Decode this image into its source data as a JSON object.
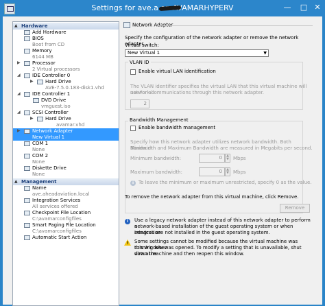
{
  "window": {
    "title": "Settings for ave.a                       on AVAMARHYPERV"
  },
  "hardware_label": "Hardware",
  "management_label": "Management",
  "hardware": [
    {
      "name": "Add Hardware",
      "sub": ""
    },
    {
      "name": "BIOS",
      "sub": "Boot from CD"
    },
    {
      "name": "Memory",
      "sub": "6144 MB"
    },
    {
      "name": "Processor",
      "sub": "2 Virtual processors"
    },
    {
      "name": "IDE Controller 0",
      "sub": ""
    },
    {
      "name": "Hard Drive",
      "sub": "AVE-7.5.0.183-disk1.vhd"
    },
    {
      "name": "IDE Controller 1",
      "sub": ""
    },
    {
      "name": "DVD Drive",
      "sub": "vmguest.iso"
    },
    {
      "name": "SCSI Controller",
      "sub": ""
    },
    {
      "name": "Hard Drive",
      "sub": "avamar.vhd"
    },
    {
      "name": "Network Adapter",
      "sub": "New Virtual  1"
    },
    {
      "name": "COM 1",
      "sub": "None"
    },
    {
      "name": "COM 2",
      "sub": "None"
    },
    {
      "name": "Diskette Drive",
      "sub": "None"
    }
  ],
  "management": [
    {
      "name": "Name",
      "sub": "ave.aheadaviation.local"
    },
    {
      "name": "Integration Services",
      "sub": "All services offered"
    },
    {
      "name": "Checkpoint File Location",
      "sub": "C:\\avamarconfigfiles"
    },
    {
      "name": "Smart Paging File Location",
      "sub": "C:\\avamarconfigfiles"
    },
    {
      "name": "Automatic Start Action",
      "sub": ""
    }
  ],
  "panel": {
    "title": "Network Adapter",
    "desc": "Specify the configuration of the network adapter or remove the network adapter.",
    "switch_label": "Virtual switch:",
    "switch_value": "New Virtual  1",
    "vlan_label": "VLAN ID",
    "vlan_checkbox": "Enable virtual LAN identification",
    "vlan_desc_1": "The VLAN identifier specifies the virtual LAN that this virtual machine will use for all",
    "vlan_desc_2": "network communications through this network adapter.",
    "vlan_value": "2",
    "bw_label": "Bandwidth Management",
    "bw_checkbox": "Enable bandwidth management",
    "bw_desc_1": "Specify how this network adapter utilizes network bandwidth. Both Minimum",
    "bw_desc_2": "Bandwidth and Maximum Bandwidth are measured in Megabits per second.",
    "min_label": "Minimum bandwidth:",
    "min_value": "0",
    "max_label": "Maximum bandwidth:",
    "max_value": "0",
    "unit": "Mbps",
    "bw_note": "To leave the minimum or maximum unrestricted, specify 0 as the value.",
    "remove_desc": "To remove the network adapter from this virtual machine, click Remove.",
    "remove_button": "Remove",
    "info_1": "Use a legacy network adapter instead of this network adapter to perform a",
    "info_2": "network-based installation of the guest operating system or when integration",
    "info_3": "services are not installed in the guest operating system.",
    "warn_1": "Some settings cannot be modified because the virtual machine was running when",
    "warn_2": "this window was opened. To modify a setting that is unavailable, shut down the",
    "warn_3": "virtual machine and then reopen this window."
  }
}
